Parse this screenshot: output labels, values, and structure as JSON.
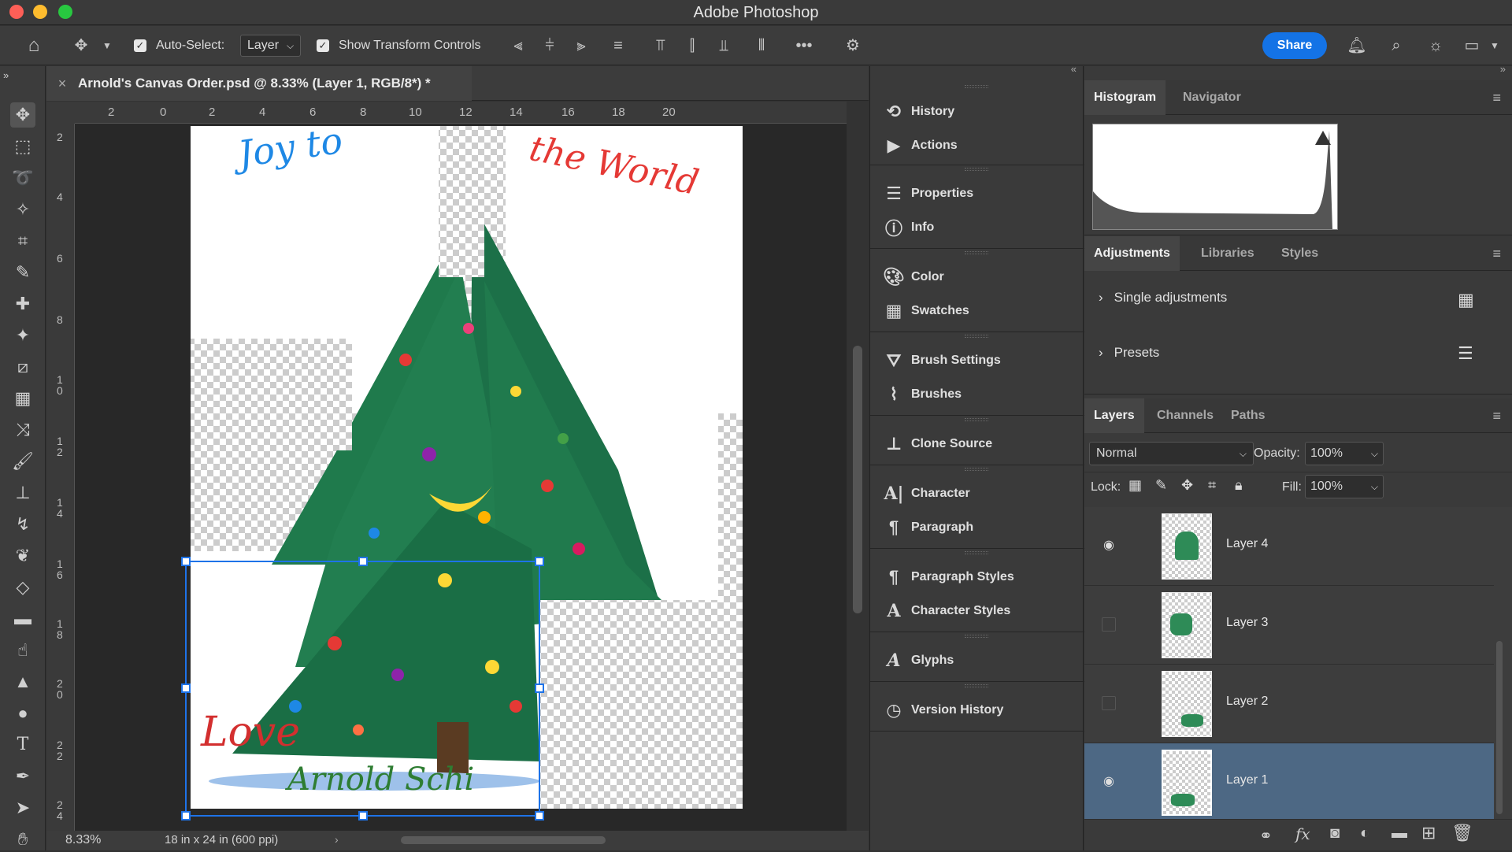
{
  "app": {
    "title": "Adobe Photoshop"
  },
  "options_bar": {
    "auto_select_label": "Auto-Select:",
    "auto_select_value": "Layer",
    "show_transform_label": "Show Transform Controls",
    "share_label": "Share"
  },
  "document": {
    "tab_title": "Arnold's Canvas Order.psd @ 8.33% (Layer 1, RGB/8*) *",
    "zoom": "8.33%",
    "doc_size": "18 in x 24 in (600 ppi)"
  },
  "rulers": {
    "h_ticks": [
      "2",
      "0",
      "2",
      "4",
      "6",
      "8",
      "10",
      "12",
      "14",
      "16",
      "18",
      "20"
    ],
    "v_ticks": [
      "2",
      "4",
      "6",
      "8",
      "1\n0",
      "1\n2",
      "1\n4",
      "1\n6",
      "1\n8",
      "2\n0",
      "2\n2",
      "2\n4"
    ]
  },
  "canvas_text": {
    "line1": "Joy to",
    "line2": "the World",
    "love": "Love",
    "signature": "Arnold Schi"
  },
  "dock": {
    "items": [
      {
        "label": "History",
        "icon": "history-panel-icon"
      },
      {
        "label": "Actions",
        "icon": "play-icon"
      },
      {
        "label": "Properties",
        "icon": "sliders-icon"
      },
      {
        "label": "Info",
        "icon": "info-icon"
      },
      {
        "label": "Color",
        "icon": "palette-icon"
      },
      {
        "label": "Swatches",
        "icon": "grid-icon"
      },
      {
        "label": "Brush Settings",
        "icon": "brush-settings-icon"
      },
      {
        "label": "Brushes",
        "icon": "brushes-icon"
      },
      {
        "label": "Clone Source",
        "icon": "stamp-icon"
      },
      {
        "label": "Character",
        "icon": "character-icon"
      },
      {
        "label": "Paragraph",
        "icon": "pilcrow-icon"
      },
      {
        "label": "Paragraph Styles",
        "icon": "paragraph-styles-icon"
      },
      {
        "label": "Character Styles",
        "icon": "character-styles-icon"
      },
      {
        "label": "Glyphs",
        "icon": "glyphs-icon"
      },
      {
        "label": "Version History",
        "icon": "clock-icon"
      }
    ]
  },
  "histogram_panel": {
    "tabs": [
      "Histogram",
      "Navigator"
    ]
  },
  "adjustments_panel": {
    "tabs": [
      "Adjustments",
      "Libraries",
      "Styles"
    ],
    "single": "Single adjustments",
    "presets": "Presets"
  },
  "layers_panel": {
    "tabs": [
      "Layers",
      "Channels",
      "Paths"
    ],
    "blend_mode": "Normal",
    "opacity_label": "Opacity:",
    "opacity": "100%",
    "lock_label": "Lock:",
    "fill_label": "Fill:",
    "fill": "100%",
    "layers": [
      {
        "name": "Layer 4",
        "visible": true,
        "selected": false
      },
      {
        "name": "Layer 3",
        "visible": false,
        "selected": false
      },
      {
        "name": "Layer 2",
        "visible": false,
        "selected": false
      },
      {
        "name": "Layer 1",
        "visible": true,
        "selected": true
      }
    ]
  },
  "colors": {
    "accent": "#1473e6",
    "selected_layer": "#4d6884"
  }
}
